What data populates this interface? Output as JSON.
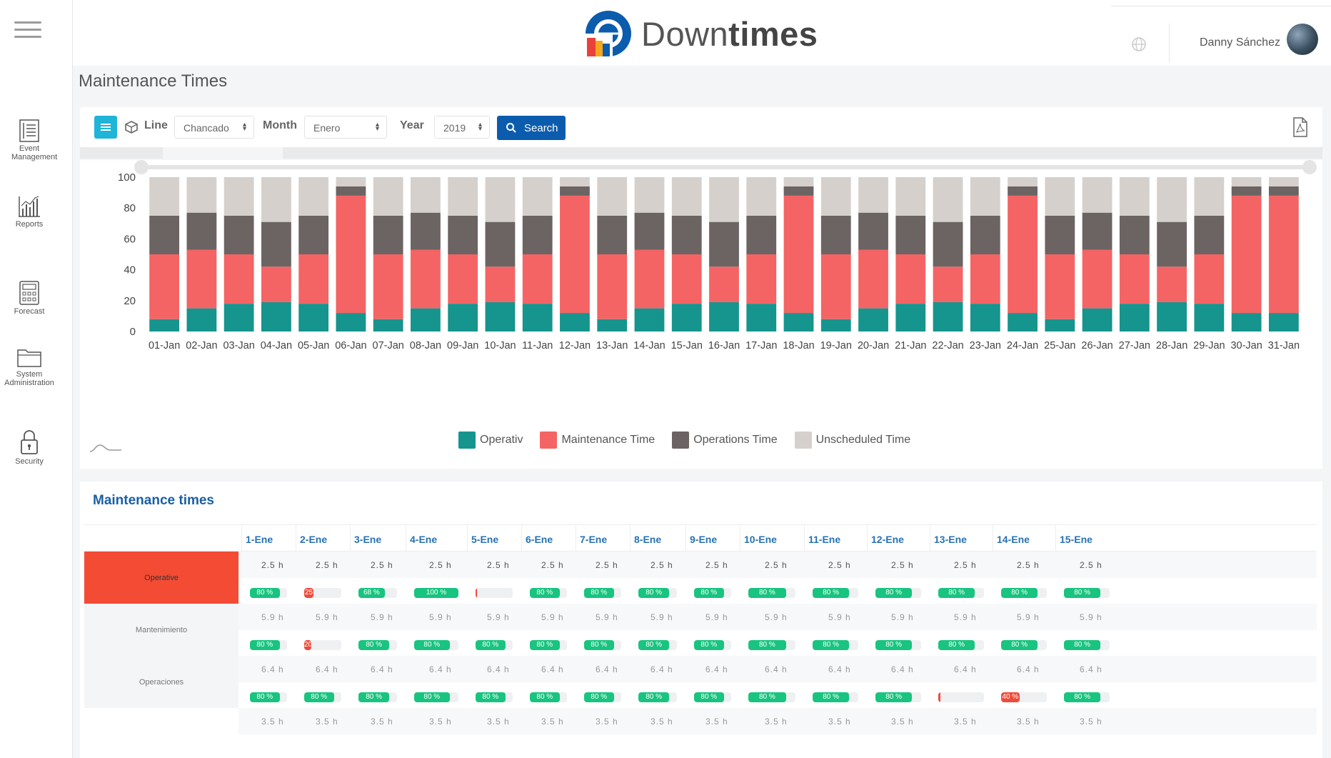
{
  "app": {
    "name_prefix": "Down",
    "name_bold": "times"
  },
  "user": {
    "name": "Danny Sánchez"
  },
  "sidebar": {
    "items": [
      {
        "label": "Event Management",
        "icon": "event-list-icon"
      },
      {
        "label": "Reports",
        "icon": "bar-chart-icon"
      },
      {
        "label": "Forecast",
        "icon": "calculator-icon"
      },
      {
        "label": "System Administration",
        "icon": "folder-icon"
      },
      {
        "label": "Security",
        "icon": "lock-icon"
      }
    ]
  },
  "page": {
    "title": "Maintenance Times"
  },
  "toolbar": {
    "line_label": "Line",
    "line_value": "Chancado",
    "month_label": "Month",
    "month_value": "Enero",
    "year_label": "Year",
    "year_value": "2019",
    "search_label": "Search"
  },
  "colors": {
    "operativ": "#16948e",
    "maintenance": "#f46464",
    "operations": "#6b6463",
    "unscheduled": "#d6d0cd",
    "accent": "#0b5cad"
  },
  "chart_data": {
    "type": "bar",
    "stacked": true,
    "categories": [
      "01-Jan",
      "02-Jan",
      "03-Jan",
      "04-Jan",
      "05-Jan",
      "06-Jan",
      "07-Jan",
      "08-Jan",
      "09-Jan",
      "10-Jan",
      "11-Jan",
      "12-Jan",
      "13-Jan",
      "14-Jan",
      "15-Jan",
      "16-Jan",
      "17-Jan",
      "18-Jan",
      "19-Jan",
      "20-Jan",
      "21-Jan",
      "22-Jan",
      "23-Jan",
      "24-Jan",
      "25-Jan",
      "26-Jan",
      "27-Jan",
      "28-Jan",
      "29-Jan",
      "30-Jan",
      "31-Jan"
    ],
    "ylim": [
      0,
      100
    ],
    "yticks": [
      0,
      20,
      40,
      60,
      80,
      100
    ],
    "legend_position": "bottom",
    "series": [
      {
        "name": "Operativ",
        "values": [
          8,
          15,
          18,
          19,
          18,
          12,
          8,
          15,
          18,
          19,
          18,
          12,
          8,
          15,
          18,
          19,
          18,
          12,
          8,
          15,
          18,
          19,
          18,
          12,
          8,
          15,
          18,
          19,
          18,
          12,
          12
        ]
      },
      {
        "name": "Maintenance Time",
        "values": [
          42,
          38,
          32,
          23,
          32,
          76,
          42,
          38,
          32,
          23,
          32,
          76,
          42,
          38,
          32,
          23,
          32,
          76,
          42,
          38,
          32,
          23,
          32,
          76,
          42,
          38,
          32,
          23,
          32,
          76,
          76
        ]
      },
      {
        "name": "Operations Time",
        "values": [
          25,
          24,
          25,
          29,
          25,
          6,
          25,
          24,
          25,
          29,
          25,
          6,
          25,
          24,
          25,
          29,
          25,
          6,
          25,
          24,
          25,
          29,
          25,
          6,
          25,
          24,
          25,
          29,
          25,
          6,
          6
        ]
      },
      {
        "name": "Unscheduled Time",
        "values": [
          25,
          23,
          25,
          29,
          25,
          6,
          25,
          23,
          25,
          29,
          25,
          6,
          25,
          23,
          25,
          29,
          25,
          6,
          25,
          23,
          25,
          29,
          25,
          6,
          25,
          23,
          25,
          29,
          25,
          6,
          6
        ]
      }
    ]
  },
  "table": {
    "title": "Maintenance times",
    "columns": [
      "1-Ene",
      "2-Ene",
      "3-Ene",
      "4-Ene",
      "5-Ene",
      "6-Ene",
      "7-Ene",
      "8-Ene",
      "9-Ene",
      "10-Ene",
      "11-Ene",
      "12-Ene",
      "13-Ene",
      "14-Ene",
      "15-Ene"
    ],
    "rows": [
      {
        "label": "Operative",
        "hours": [
          "2.5 h",
          "2.5 h",
          "2.5 h",
          "2.5 h",
          "2.5 h",
          "2.5 h",
          "2.5 h",
          "2.5 h",
          "2.5 h",
          "2.5 h",
          "2.5 h",
          "2.5 h",
          "2.5 h",
          "2.5 h",
          "2.5 h"
        ],
        "bars": [
          {
            "pct": 80,
            "text": "80 %",
            "red": false
          },
          {
            "pct": 25,
            "text": "25",
            "red": true
          },
          {
            "pct": 68,
            "text": "68 %",
            "red": false
          },
          {
            "pct": 100,
            "text": "100 %",
            "red": false
          },
          {
            "pct": 2,
            "text": "",
            "red": true
          },
          {
            "pct": 80,
            "text": "80 %",
            "red": false
          },
          {
            "pct": 80,
            "text": "80 %",
            "red": false
          },
          {
            "pct": 80,
            "text": "80 %",
            "red": false
          },
          {
            "pct": 80,
            "text": "80 %",
            "red": false
          },
          {
            "pct": 80,
            "text": "80 %",
            "red": false
          },
          {
            "pct": 80,
            "text": "80 %",
            "red": false
          },
          {
            "pct": 80,
            "text": "80 %",
            "red": false
          },
          {
            "pct": 80,
            "text": "80 %",
            "red": false
          },
          {
            "pct": 80,
            "text": "80 %",
            "red": false
          },
          {
            "pct": 80,
            "text": "80 %",
            "red": false
          }
        ]
      },
      {
        "label": "Mantenimiento",
        "hours": [
          "5.9 h",
          "5.9 h",
          "5.9 h",
          "5.9 h",
          "5.9 h",
          "5.9 h",
          "5.9 h",
          "5.9 h",
          "5.9 h",
          "5.9 h",
          "5.9 h",
          "5.9 h",
          "5.9 h",
          "5.9 h",
          "5.9 h"
        ],
        "bars": [
          {
            "pct": 80,
            "text": "80 %",
            "red": false
          },
          {
            "pct": 20,
            "text": "20",
            "red": true
          },
          {
            "pct": 80,
            "text": "80 %",
            "red": false
          },
          {
            "pct": 80,
            "text": "80 %",
            "red": false
          },
          {
            "pct": 80,
            "text": "80 %",
            "red": false
          },
          {
            "pct": 80,
            "text": "80 %",
            "red": false
          },
          {
            "pct": 80,
            "text": "80 %",
            "red": false
          },
          {
            "pct": 80,
            "text": "80 %",
            "red": false
          },
          {
            "pct": 80,
            "text": "80 %",
            "red": false
          },
          {
            "pct": 80,
            "text": "80 %",
            "red": false
          },
          {
            "pct": 80,
            "text": "80 %",
            "red": false
          },
          {
            "pct": 80,
            "text": "80 %",
            "red": false
          },
          {
            "pct": 80,
            "text": "80 %",
            "red": false
          },
          {
            "pct": 80,
            "text": "80 %",
            "red": false
          },
          {
            "pct": 80,
            "text": "80 %",
            "red": false
          }
        ]
      },
      {
        "label": "Operaciones",
        "hours": [
          "6.4 h",
          "6.4 h",
          "6.4 h",
          "6.4 h",
          "6.4 h",
          "6.4 h",
          "6.4 h",
          "6.4 h",
          "6.4 h",
          "6.4 h",
          "6.4 h",
          "6.4 h",
          "6.4 h",
          "6.4 h",
          "6.4 h"
        ],
        "bars": [
          {
            "pct": 80,
            "text": "80 %",
            "red": false
          },
          {
            "pct": 80,
            "text": "80 %",
            "red": false
          },
          {
            "pct": 80,
            "text": "80 %",
            "red": false
          },
          {
            "pct": 80,
            "text": "80 %",
            "red": false
          },
          {
            "pct": 80,
            "text": "80 %",
            "red": false
          },
          {
            "pct": 80,
            "text": "80 %",
            "red": false
          },
          {
            "pct": 80,
            "text": "80 %",
            "red": false
          },
          {
            "pct": 80,
            "text": "80 %",
            "red": false
          },
          {
            "pct": 80,
            "text": "80 %",
            "red": false
          },
          {
            "pct": 80,
            "text": "80 %",
            "red": false
          },
          {
            "pct": 80,
            "text": "80 %",
            "red": false
          },
          {
            "pct": 80,
            "text": "80 %",
            "red": false
          },
          {
            "pct": 5,
            "text": "",
            "red": true
          },
          {
            "pct": 40,
            "text": "40 %",
            "red": true
          },
          {
            "pct": 80,
            "text": "80 %",
            "red": false
          }
        ]
      },
      {
        "label": "",
        "hours": [
          "3.5 h",
          "3.5 h",
          "3.5 h",
          "3.5 h",
          "3.5 h",
          "3.5 h",
          "3.5 h",
          "3.5 h",
          "3.5 h",
          "3.5 h",
          "3.5 h",
          "3.5 h",
          "3.5 h",
          "3.5 h",
          "3.5 h"
        ],
        "bars": []
      }
    ]
  }
}
